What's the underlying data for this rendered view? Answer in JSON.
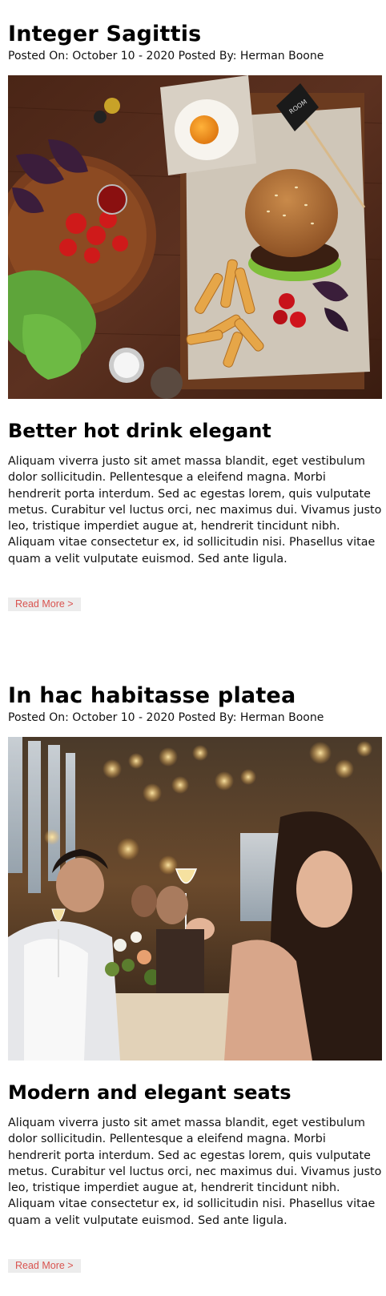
{
  "posts": [
    {
      "title": "Integer Sagittis",
      "meta": "Posted On: October 10 - 2020 Posted By: Herman Boone",
      "image_alt": "burger-and-salad-photo",
      "subtitle": "Better hot drink elegant",
      "body": "Aliquam viverra justo sit amet massa blandit, eget vestibulum dolor sollicitudin. Pellentesque a eleifend magna. Morbi hendrerit porta interdum. Sed ac egestas lorem, quis vulputate metus. Curabitur vel luctus orci, nec maximus dui. Vivamus justo leo, tristique imperdiet augue at, hendrerit tincidunt nibh. Aliquam vitae consectetur ex, id sollicitudin nisi. Phasellus vitae quam a velit vulputate euismod. Sed ante ligula.",
      "read_more": "Read More >",
      "flag_text": "ROOM"
    },
    {
      "title": "In hac habitasse platea",
      "meta": "Posted On: October 10 - 2020 Posted By: Herman Boone",
      "image_alt": "restaurant-celebration-photo",
      "subtitle": "Modern and elegant seats",
      "body": "Aliquam viverra justo sit amet massa blandit, eget vestibulum dolor sollicitudin. Pellentesque a eleifend magna. Morbi hendrerit porta interdum. Sed ac egestas lorem, quis vulputate metus. Curabitur vel luctus orci, nec maximus dui. Vivamus justo leo, tristique imperdiet augue at, hendrerit tincidunt nibh. Aliquam vitae consectetur ex, id sollicitudin nisi. Phasellus vitae quam a velit vulputate euismod. Sed ante ligula.",
      "read_more": "Read More >"
    }
  ],
  "colors": {
    "read_more_text": "#d9534f",
    "read_more_bg": "#ececec"
  }
}
